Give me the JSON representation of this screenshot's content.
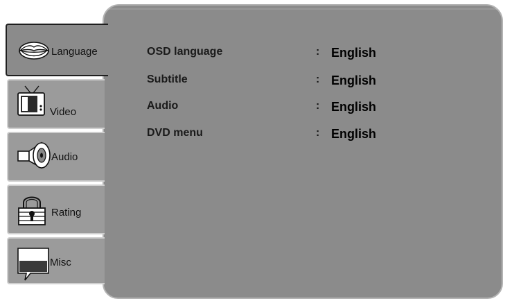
{
  "sidebar": {
    "tabs": [
      {
        "id": "language",
        "label": "Language",
        "icon": "lips-icon",
        "active": true
      },
      {
        "id": "video",
        "label": "Video",
        "icon": "tv-icon",
        "active": false
      },
      {
        "id": "audio",
        "label": "Audio",
        "icon": "speaker-icon",
        "active": false
      },
      {
        "id": "rating",
        "label": "Rating",
        "icon": "padlock-icon",
        "active": false
      },
      {
        "id": "misc",
        "label": "Misc",
        "icon": "speech-bubble-icon",
        "active": false
      }
    ]
  },
  "language_settings": {
    "rows": [
      {
        "label": "OSD language",
        "separator": ":",
        "value": "English"
      },
      {
        "label": "Subtitle",
        "separator": ":",
        "value": "English"
      },
      {
        "label": "Audio",
        "separator": ":",
        "value": "English"
      },
      {
        "label": "DVD menu",
        "separator": ":",
        "value": "English"
      }
    ]
  },
  "colors": {
    "panel": "#8b8b8b",
    "tab": "#9b9b9b",
    "panel_border": "#b3b3b3",
    "active_tab_border": "#1f1f1f"
  }
}
